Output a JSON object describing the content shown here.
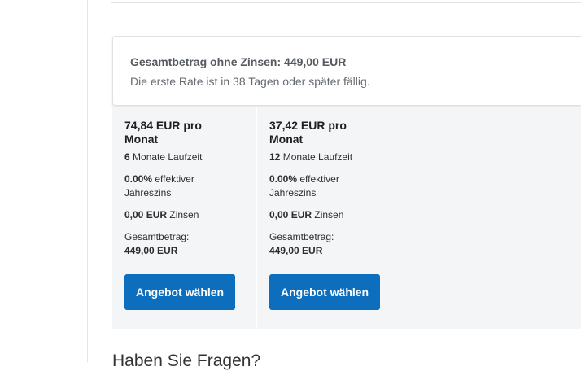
{
  "summary": {
    "title": "Gesamtbetrag ohne Zinsen: 449,00 EUR",
    "subtitle": "Die erste Rate ist in 38 Tagen oder später fällig."
  },
  "plans": [
    {
      "monthly": "74,84 EUR pro Monat",
      "duration_value": "6",
      "duration_label": " Monate Laufzeit",
      "rate_value": "0.00%",
      "rate_label": " effektiver Jahreszins",
      "interest_value": "0,00 EUR",
      "interest_label": " Zinsen",
      "total_label": "Gesamtbetrag:",
      "total_value": "449,00 EUR",
      "button_label": "Angebot wählen"
    },
    {
      "monthly": "37,42 EUR pro Monat",
      "duration_value": "12",
      "duration_label": " Monate Laufzeit",
      "rate_value": "0.00%",
      "rate_label": " effektiver Jahreszins",
      "interest_value": "0,00 EUR",
      "interest_label": " Zinsen",
      "total_label": "Gesamtbetrag:",
      "total_value": "449,00 EUR",
      "button_label": "Angebot wählen"
    }
  ],
  "footer": {
    "questions_heading": "Haben Sie Fragen?"
  },
  "colors": {
    "button_bg": "#0d6ebd",
    "panel_bg": "#f4f5f7"
  }
}
